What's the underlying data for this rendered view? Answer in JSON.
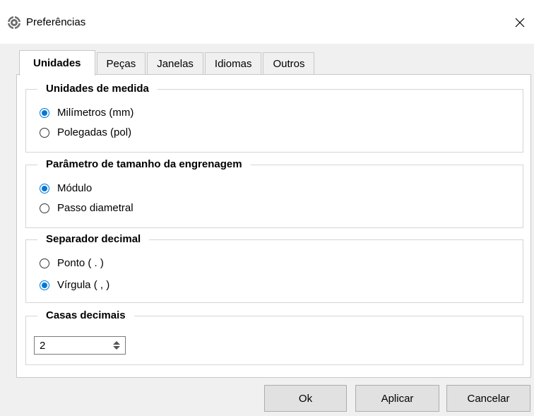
{
  "window": {
    "title": "Preferências",
    "app_icon": "gear-app-icon",
    "close_icon": "close-icon"
  },
  "tabs": [
    {
      "label": "Unidades",
      "active": true
    },
    {
      "label": "Peças",
      "active": false
    },
    {
      "label": "Janelas",
      "active": false
    },
    {
      "label": "Idiomas",
      "active": false
    },
    {
      "label": "Outros",
      "active": false
    }
  ],
  "groups": {
    "units": {
      "title": "Unidades de medida",
      "options": [
        {
          "label": "Milímetros (mm)",
          "checked": true
        },
        {
          "label": "Polegadas (pol)",
          "checked": false
        }
      ]
    },
    "gear_size": {
      "title": "Parâmetro de tamanho da engrenagem",
      "options": [
        {
          "label": "Módulo",
          "checked": true
        },
        {
          "label": "Passo diametral",
          "checked": false
        }
      ]
    },
    "decimal_separator": {
      "title": "Separador decimal",
      "options": [
        {
          "label": "Ponto ( . )",
          "checked": false
        },
        {
          "label": "Vírgula ( , )",
          "checked": true
        }
      ]
    },
    "decimal_places": {
      "title": "Casas decimais",
      "value": "2"
    }
  },
  "buttons": {
    "ok": "Ok",
    "apply": "Aplicar",
    "cancel": "Cancelar"
  },
  "colors": {
    "accent": "#0078d7",
    "client_bg": "#f0f0f0"
  }
}
